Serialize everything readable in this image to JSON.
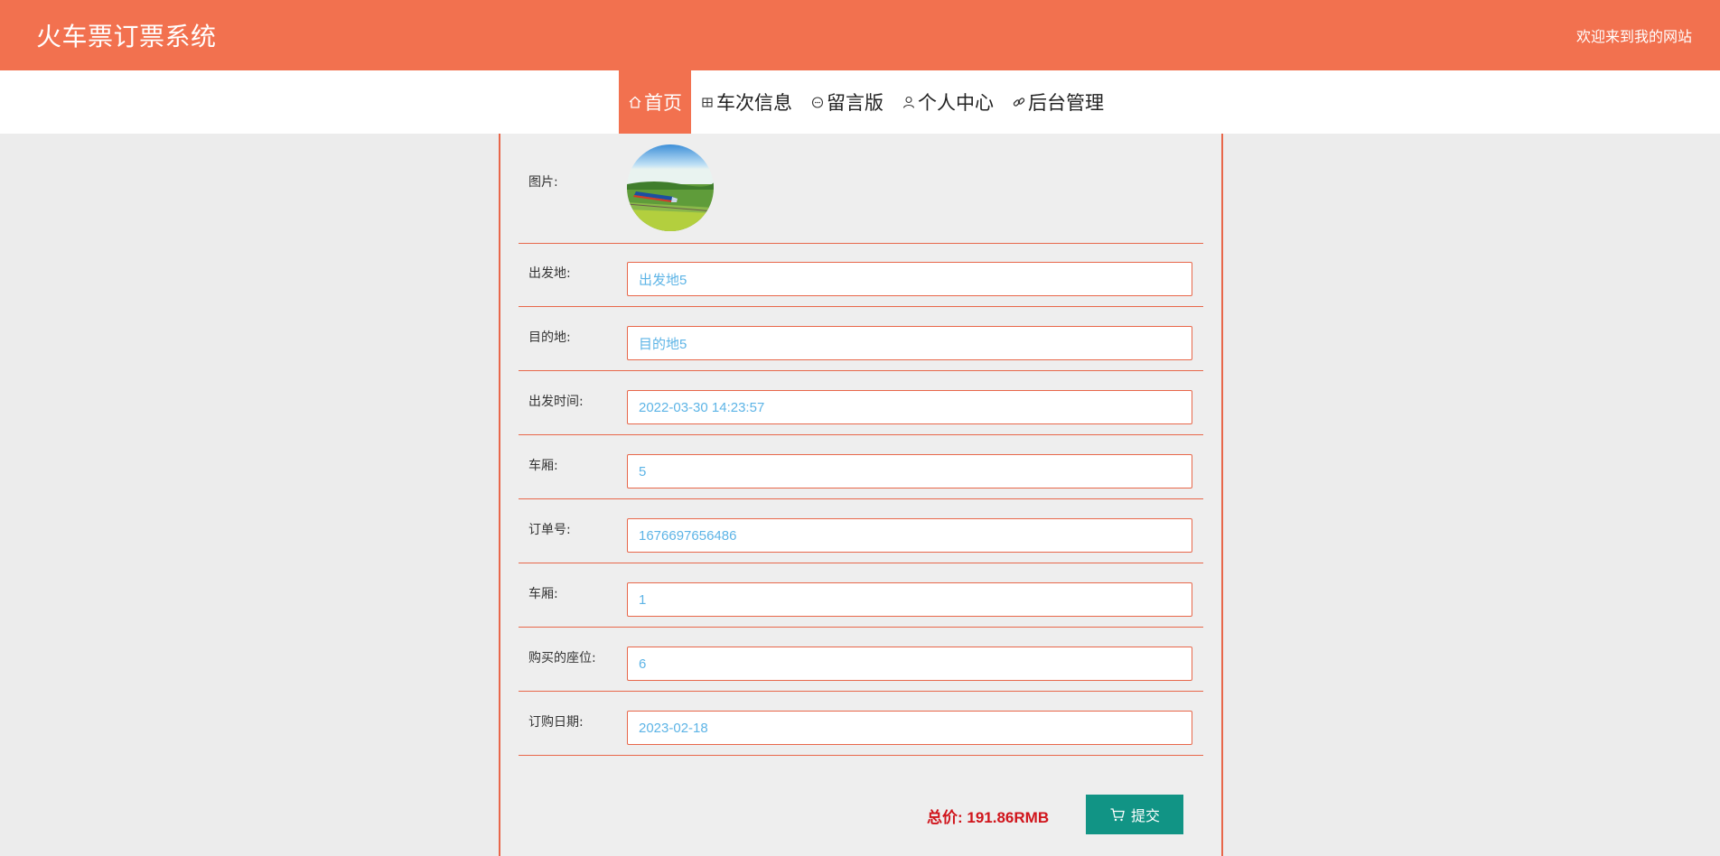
{
  "header": {
    "title": "火车票订票系统",
    "welcome": "欢迎来到我的网站"
  },
  "nav": {
    "items": [
      {
        "label": "首页",
        "icon": "home-icon",
        "active": true
      },
      {
        "label": "车次信息",
        "icon": "grid-icon",
        "active": false
      },
      {
        "label": "留言版",
        "icon": "chat-icon",
        "active": false
      },
      {
        "label": "个人中心",
        "icon": "user-icon",
        "active": false
      },
      {
        "label": "后台管理",
        "icon": "link-icon",
        "active": false
      }
    ]
  },
  "form": {
    "image_label": "图片:",
    "fields": [
      {
        "label": "出发地:",
        "value": "出发地5"
      },
      {
        "label": "目的地:",
        "value": "目的地5"
      },
      {
        "label": "出发时间:",
        "value": "2022-03-30 14:23:57"
      },
      {
        "label": "车厢:",
        "value": "5"
      },
      {
        "label": "订单号:",
        "value": "1676697656486"
      },
      {
        "label": "车厢:",
        "value": "1"
      },
      {
        "label": "购买的座位:",
        "value": "6"
      },
      {
        "label": "订购日期:",
        "value": "2023-02-18"
      }
    ]
  },
  "footer": {
    "total": "总价: 191.86RMB",
    "submit_label": "提交"
  },
  "colors": {
    "brand": "#f2714f",
    "border": "#e8674a",
    "submit": "#119485",
    "total": "#d0141b",
    "input_text": "#5db4e6"
  }
}
